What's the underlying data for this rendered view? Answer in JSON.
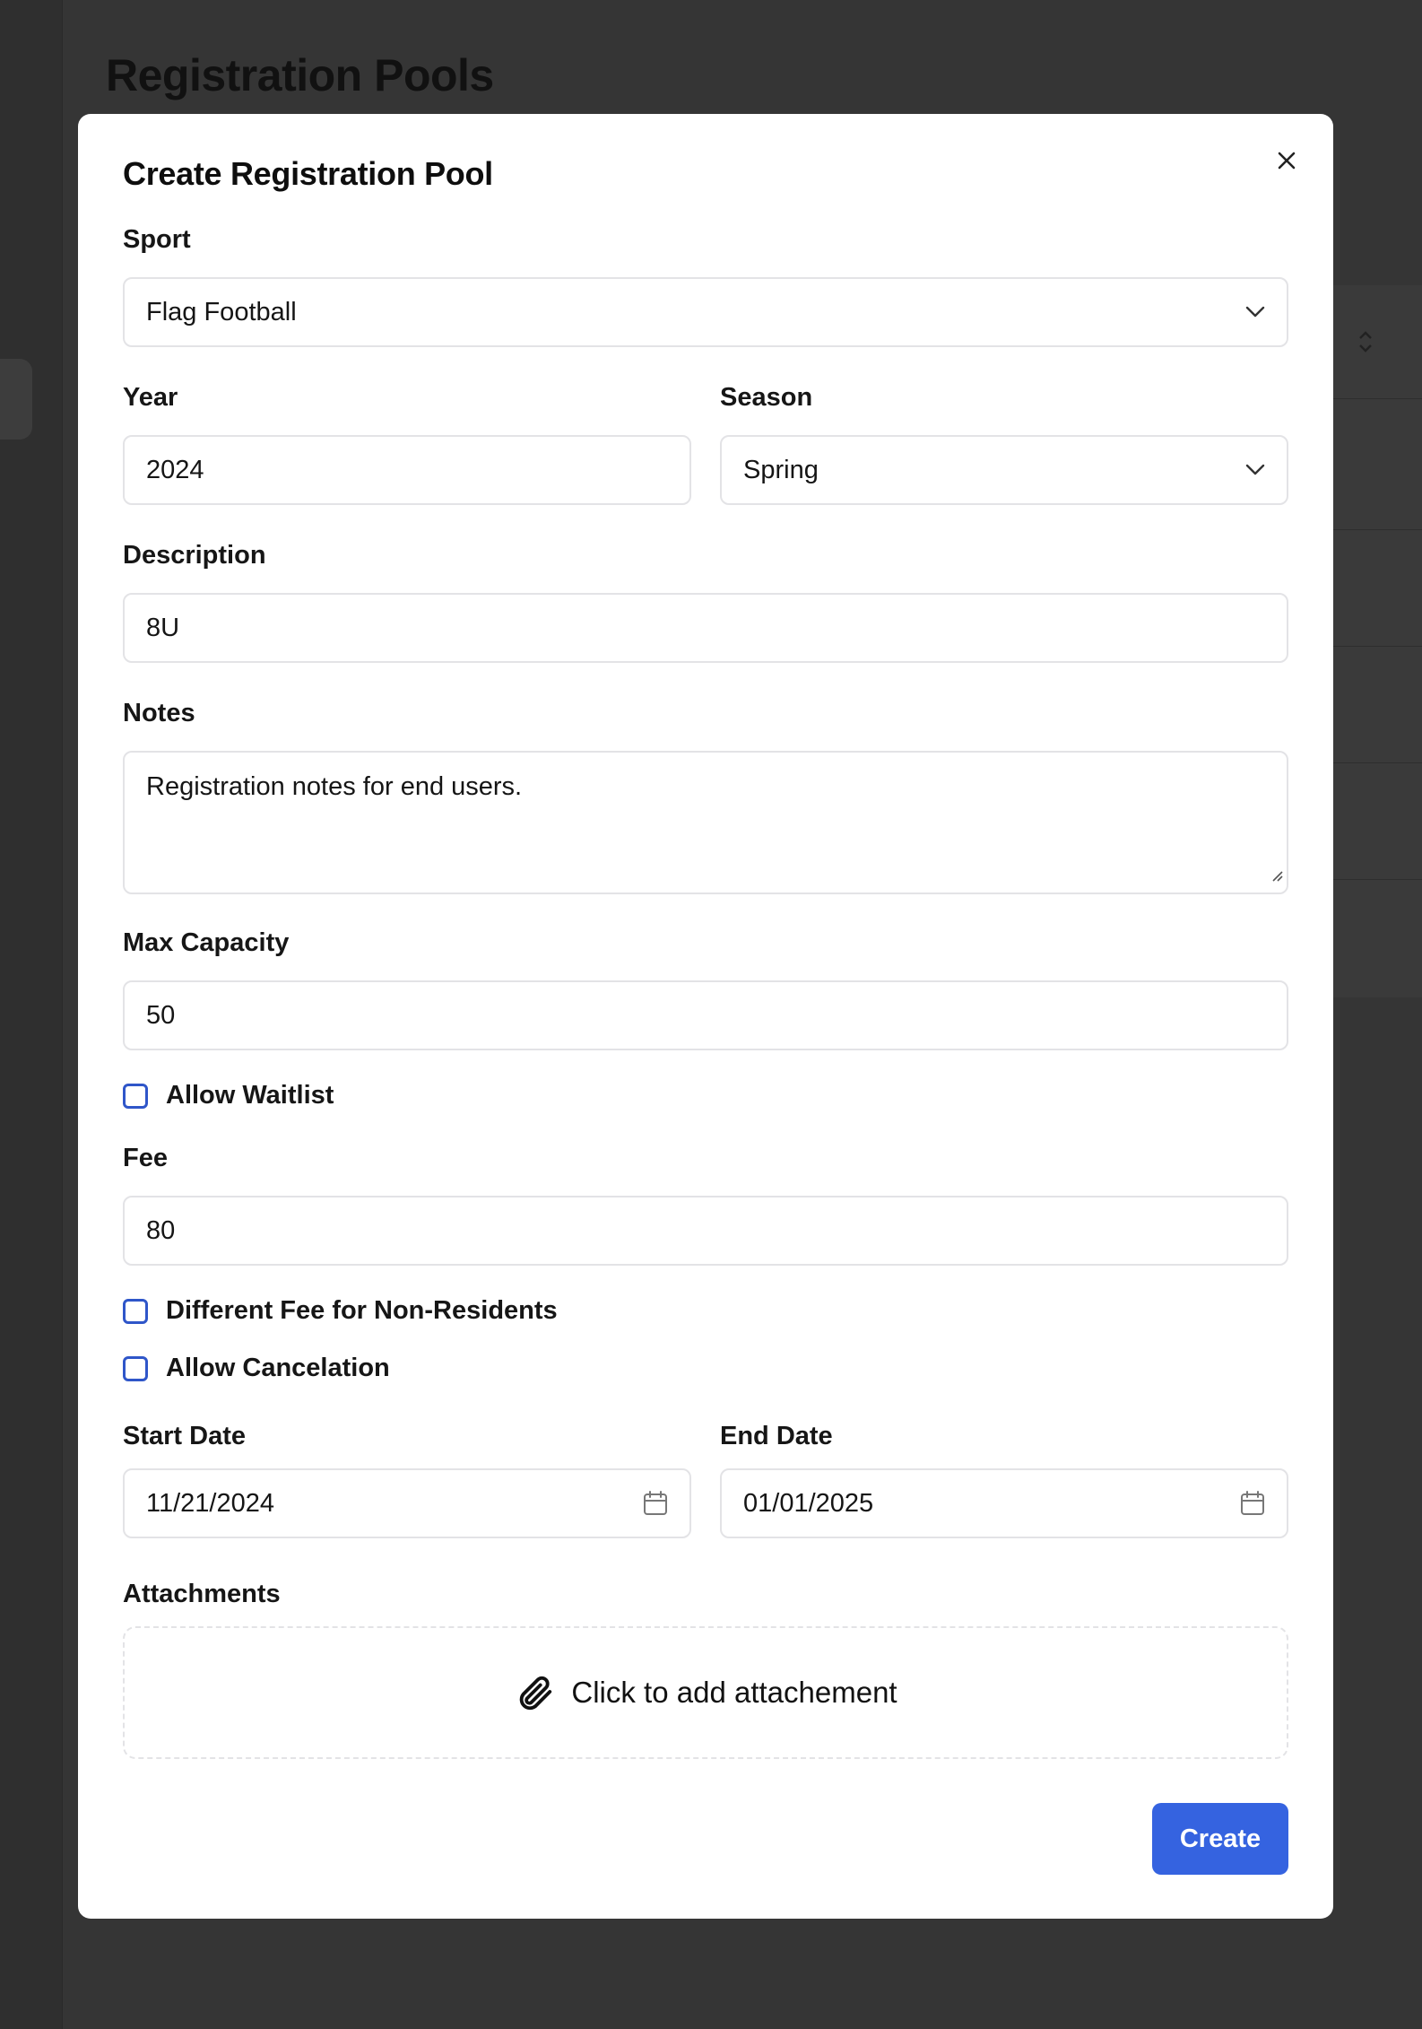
{
  "background": {
    "page_title": "Registration Pools"
  },
  "modal": {
    "title": "Create Registration Pool",
    "close_icon": "close-icon",
    "sport": {
      "label": "Sport",
      "value": "Flag Football",
      "icon": "chevron-down-icon"
    },
    "year": {
      "label": "Year",
      "value": "2024"
    },
    "season": {
      "label": "Season",
      "value": "Spring",
      "icon": "chevron-down-icon"
    },
    "description": {
      "label": "Description",
      "value": "8U"
    },
    "notes": {
      "label": "Notes",
      "value": "Registration notes for end users."
    },
    "max_capacity": {
      "label": "Max Capacity",
      "value": "50"
    },
    "allow_waitlist": {
      "label": "Allow Waitlist",
      "checked": false
    },
    "fee": {
      "label": "Fee",
      "value": "80"
    },
    "different_fee": {
      "label": "Different Fee for Non-Residents",
      "checked": false
    },
    "allow_cancelation": {
      "label": "Allow Cancelation",
      "checked": false
    },
    "start_date": {
      "label": "Start Date",
      "value": "11/21/2024",
      "icon": "calendar-icon"
    },
    "end_date": {
      "label": "End Date",
      "value": "01/01/2025",
      "icon": "calendar-icon"
    },
    "attachments": {
      "label": "Attachments",
      "cta": "Click to add attachement",
      "icon": "paperclip-icon"
    },
    "create_label": "Create"
  },
  "colors": {
    "primary": "#3563e0",
    "checkbox_border": "#2f56c9",
    "overlay": "#353535",
    "field_border": "#e3e3e6"
  }
}
